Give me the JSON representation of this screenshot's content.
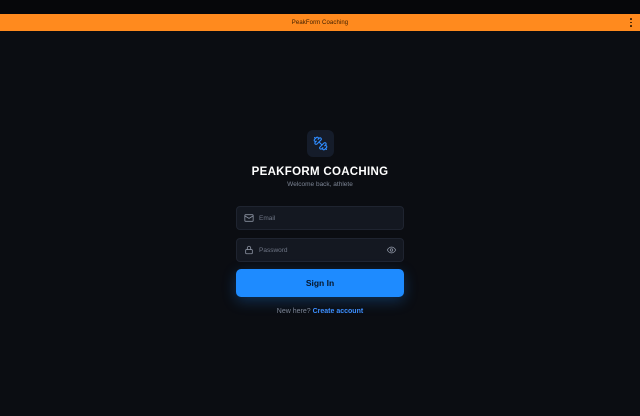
{
  "window": {
    "title": "PeakForm Coaching"
  },
  "brand": {
    "name": "PEAKFORM COACHING",
    "tagline": "Welcome back, athlete",
    "accent": "#1e8bff",
    "logo_icon": "dumbbell-icon"
  },
  "form": {
    "email_placeholder": "Email",
    "email_value": "",
    "email_icon": "mail-icon",
    "password_placeholder": "Password",
    "password_value": "",
    "password_icon": "lock-icon",
    "reveal_icon": "eye-icon",
    "submit_label": "Sign In"
  },
  "footer": {
    "prompt": "New here?",
    "link_label": "Create account"
  },
  "colors": {
    "title_bar": "#ff8a1e",
    "background": "#0b0d12",
    "field_bg": "#141821",
    "link": "#3d8fff"
  }
}
